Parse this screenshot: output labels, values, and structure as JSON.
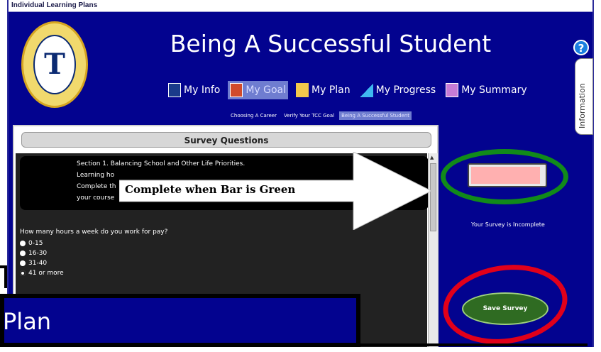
{
  "window": {
    "title": "Individual Learning Plans"
  },
  "header": {
    "page_title": "Being A Successful Student",
    "help_label": "?",
    "info_tab_label": "Information"
  },
  "nav": {
    "items": [
      {
        "label": "My Info",
        "active": false
      },
      {
        "label": "My Goal",
        "active": true
      },
      {
        "label": "My Plan",
        "active": false
      },
      {
        "label": "My Progress",
        "active": false
      },
      {
        "label": "My Summary",
        "active": false
      }
    ]
  },
  "subnav": {
    "items": [
      {
        "label": "Choosing A Career",
        "active": false
      },
      {
        "label": "Verify Your TCC Goal",
        "active": false
      },
      {
        "label": "Being A Successful Student",
        "active": true
      }
    ]
  },
  "survey": {
    "header": "Survey Questions",
    "section_lines": [
      "Section 1. Balancing School and Other Life Priorities.",
      "Learning ho",
      "Complete th",
      "your course"
    ],
    "question": "How many hours a week do you work for pay?",
    "options": [
      {
        "label": "0-15",
        "selected": false
      },
      {
        "label": "16-30",
        "selected": false
      },
      {
        "label": "31-40",
        "selected": false
      },
      {
        "label": "41 or more",
        "selected": true
      }
    ]
  },
  "progress": {
    "fraction": 0.95
  },
  "status_text": "Your Survey is Incomplete",
  "save_button_label": "Save Survey",
  "annotation": {
    "callout_text": "Complete when Bar is Green"
  },
  "overlay": {
    "text": "Plan"
  },
  "colors": {
    "window_bg": "#03038f",
    "active_nav": "#6f7dd0",
    "progress_fill": "#ffb0b0",
    "green_annotation": "#118a1a",
    "red_annotation": "#e1001a"
  }
}
